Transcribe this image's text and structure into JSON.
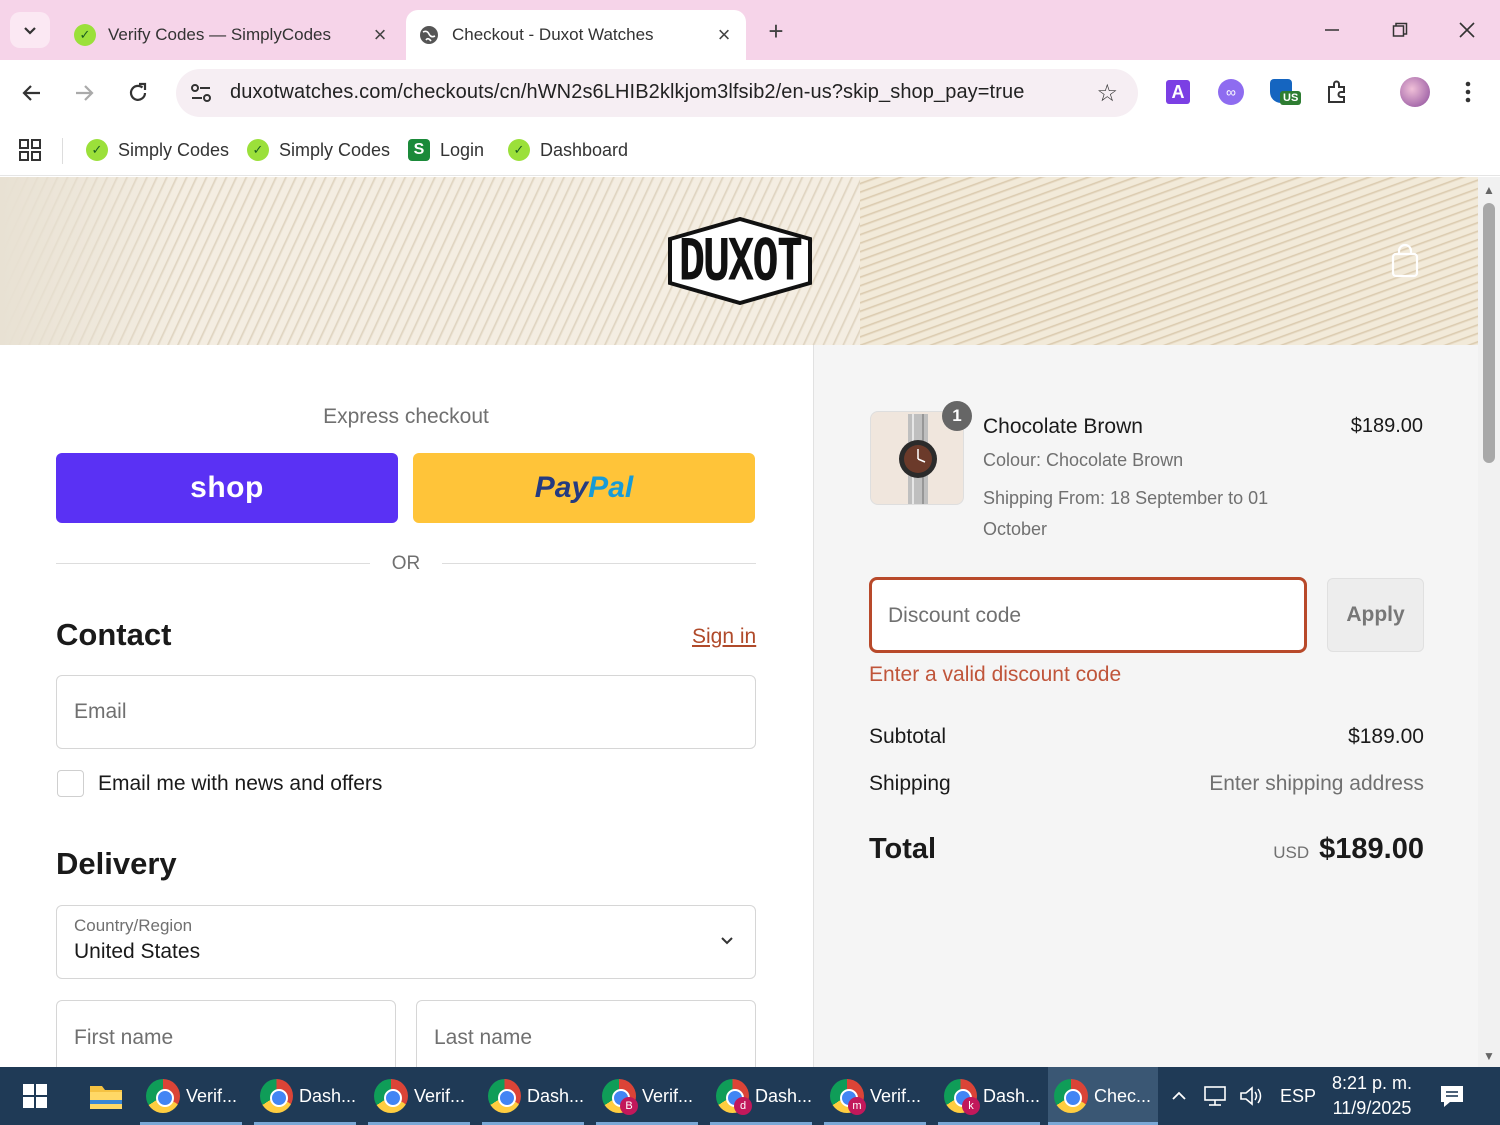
{
  "browser": {
    "tabs": [
      {
        "title": "Verify Codes — SimplyCodes",
        "active": false
      },
      {
        "title": "Checkout - Duxot Watches",
        "active": true
      }
    ],
    "url": "duxotwatches.com/checkouts/cn/hWN2s6LHIB2klkjom3lfsib2/en-us?skip_shop_pay=true",
    "extension_badge": "US",
    "bookmarks": [
      {
        "label": "Simply Codes",
        "icon": "simplycodes-icon"
      },
      {
        "label": "Simply Codes",
        "icon": "simplycodes-icon"
      },
      {
        "label": "Login",
        "icon": "s-logo-icon"
      },
      {
        "label": "Dashboard",
        "icon": "simplycodes-icon"
      }
    ]
  },
  "store": {
    "logo_text": "DUXOT"
  },
  "checkout": {
    "express_title": "Express checkout",
    "shop_label": "shop",
    "paypal_pay": "Pay",
    "paypal_pal": "Pal",
    "or_label": "OR",
    "contact_heading": "Contact",
    "sign_in": "Sign in",
    "email_placeholder": "Email",
    "news_label": "Email me with news and offers",
    "delivery_heading": "Delivery",
    "country_label": "Country/Region",
    "country_value": "United States",
    "first_name_placeholder": "First name",
    "last_name_placeholder": "Last name"
  },
  "summary": {
    "product_name": "Chocolate Brown",
    "product_price": "$189.00",
    "quantity": "1",
    "colour": "Colour: Chocolate Brown",
    "shipping_from": "Shipping From: 18 September to 01 October",
    "discount_placeholder": "Discount code",
    "apply_label": "Apply",
    "discount_error": "Enter a valid discount code",
    "subtotal_label": "Subtotal",
    "subtotal_value": "$189.00",
    "shipping_label": "Shipping",
    "shipping_value": "Enter shipping address",
    "total_label": "Total",
    "total_currency": "USD",
    "total_value": "$189.00"
  },
  "taskbar": {
    "items": [
      {
        "label": "Verif...",
        "badge": ""
      },
      {
        "label": "Dash...",
        "badge": ""
      },
      {
        "label": "Verif...",
        "badge": ""
      },
      {
        "label": "Dash...",
        "badge": ""
      },
      {
        "label": "Verif...",
        "badge": "B"
      },
      {
        "label": "Dash...",
        "badge": "d"
      },
      {
        "label": "Verif...",
        "badge": "m"
      },
      {
        "label": "Dash...",
        "badge": "k"
      },
      {
        "label": "Chec...",
        "badge": ""
      }
    ],
    "language": "ESP",
    "time": "8:21 p. m.",
    "date": "11/9/2025"
  },
  "colors": {
    "tabbar_bg": "#f6d4e9",
    "shop_purple": "#5a31f4",
    "paypal_yellow": "#ffc439",
    "error_red": "#c0553a",
    "taskbar_bg": "#1f3a56"
  }
}
